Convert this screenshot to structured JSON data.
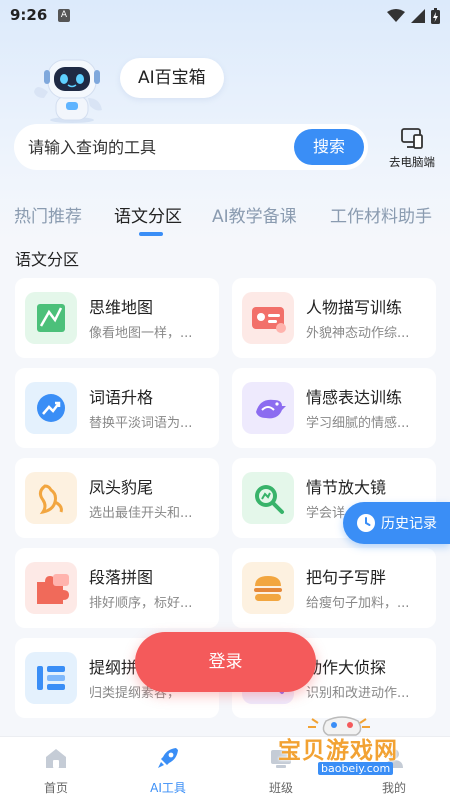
{
  "status_bar": {
    "time": "9:26",
    "notif_letter": "A"
  },
  "header": {
    "bubble_title": "AI百宝箱"
  },
  "search": {
    "placeholder": "请输入查询的工具",
    "button_label": "搜索"
  },
  "pc_link": {
    "label": "去电脑端"
  },
  "tabs": [
    {
      "label": "热门推荐",
      "active": false
    },
    {
      "label": "语文分区",
      "active": true
    },
    {
      "label": "AI教学备课",
      "active": false
    },
    {
      "label": "工作材料助手",
      "active": false
    }
  ],
  "section": {
    "title": "语文分区"
  },
  "tools": [
    {
      "title": "思维地图",
      "desc": "像看地图一样，...",
      "icon": "map-icon",
      "icon_bg": "#e4f7ea",
      "icon_color": "#4cc07a"
    },
    {
      "title": "人物描写训练",
      "desc": "外貌神态动作综...",
      "icon": "id-card-icon",
      "icon_bg": "#fde9e6",
      "icon_color": "#f2706a"
    },
    {
      "title": "词语升格",
      "desc": "替换平淡词语为...",
      "icon": "trend-up-icon",
      "icon_bg": "#e4f1fd",
      "icon_color": "#3a8ef6"
    },
    {
      "title": "情感表达训练",
      "desc": "学习细腻的情感...",
      "icon": "bird-icon",
      "icon_bg": "#eeeafd",
      "icon_color": "#8c6cf0"
    },
    {
      "title": "凤头豹尾",
      "desc": "选出最佳开头和...",
      "icon": "phoenix-icon",
      "icon_bg": "#fdf1e0",
      "icon_color": "#f2a640"
    },
    {
      "title": "情节放大镜",
      "desc": "学会详",
      "icon": "magnifier-icon",
      "icon_bg": "#e4f7ea",
      "icon_color": "#38b36a"
    },
    {
      "title": "段落拼图",
      "desc": "排好顺序，标好...",
      "icon": "puzzle-icon",
      "icon_bg": "#fde9e6",
      "icon_color": "#f06a5a"
    },
    {
      "title": "把句子写胖",
      "desc": "给瘦句子加料，...",
      "icon": "burger-icon",
      "icon_bg": "#fdf1e0",
      "icon_color": "#f2a640"
    },
    {
      "title": "提纲拼",
      "desc": "归类提纲素容，",
      "icon": "outline-icon",
      "icon_bg": "#e4f1fd",
      "icon_color": "#3a8ef6"
    },
    {
      "title": "动作大侦探",
      "desc": "识别和改进动作...",
      "icon": "detective-icon",
      "icon_bg": "#eeeafd",
      "icon_color": "#8c6cf0"
    }
  ],
  "history_button": {
    "label": "历史记录"
  },
  "login_button": {
    "label": "登录"
  },
  "tabbar": [
    {
      "label": "首页",
      "icon": "home-icon",
      "active": false
    },
    {
      "label": "AI工具",
      "icon": "rocket-icon",
      "active": true
    },
    {
      "label": "班级",
      "icon": "class-icon",
      "active": false
    },
    {
      "label": "我的",
      "icon": "profile-icon",
      "active": false
    }
  ],
  "watermark": {
    "text": "宝贝游戏网",
    "url": "baobeiy.com"
  },
  "colors": {
    "accent": "#3a8ef6",
    "login": "#f45a5b",
    "inactive_tab": "#8a9bb0"
  }
}
